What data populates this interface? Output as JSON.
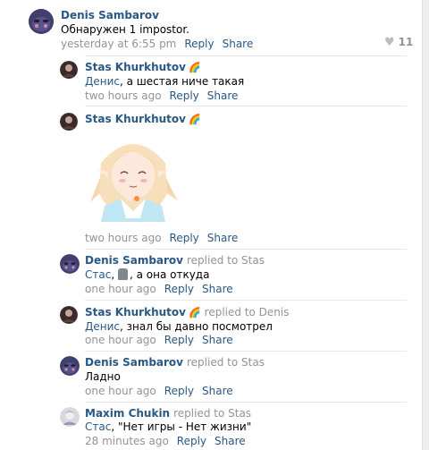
{
  "comments": [
    {
      "author": "Denis Sambarov",
      "text": "Обнаружен 1 impostor.",
      "time": "yesterday at 6:55 pm",
      "reply_label": "Reply",
      "share_label": "Share",
      "likes": "11"
    },
    {
      "author": "Stas Khurkhutov",
      "badge": "🌈",
      "mention": "Денис",
      "text": ", а шестая ниче такая",
      "time": "two hours ago",
      "reply_label": "Reply",
      "share_label": "Share"
    },
    {
      "author": "Stas Khurkhutov",
      "badge": "🌈",
      "time": "two hours ago",
      "reply_label": "Reply",
      "share_label": "Share"
    },
    {
      "author": "Denis Sambarov",
      "replied_to": "replied to Stas",
      "mention": "Стас",
      "text_after_emoji": ", а она откуда",
      "text_prefix": ", ",
      "time": "one hour ago",
      "reply_label": "Reply",
      "share_label": "Share"
    },
    {
      "author": "Stas Khurkhutov",
      "badge": "🌈",
      "replied_to": "replied to Denis",
      "mention": "Денис",
      "text": ", знал бы давно посмотрел",
      "time": "one hour ago",
      "reply_label": "Reply",
      "share_label": "Share"
    },
    {
      "author": "Denis Sambarov",
      "replied_to": "replied to Stas",
      "text": "Ладно",
      "time": "one hour ago",
      "reply_label": "Reply",
      "share_label": "Share"
    },
    {
      "author": "Maxim Chukin",
      "replied_to": "replied to Stas",
      "mention": "Стас",
      "text": ", \"Нет игры - Нет жизни\"",
      "time": "28 minutes ago",
      "reply_label": "Reply",
      "share_label": "Share"
    }
  ],
  "colors": {
    "link": "#2a5885",
    "muted": "#939393",
    "background": "#ffffff",
    "separator": "#e7e8ec"
  },
  "icons": {
    "like": "heart-icon",
    "emoji": "moai-emoji"
  }
}
